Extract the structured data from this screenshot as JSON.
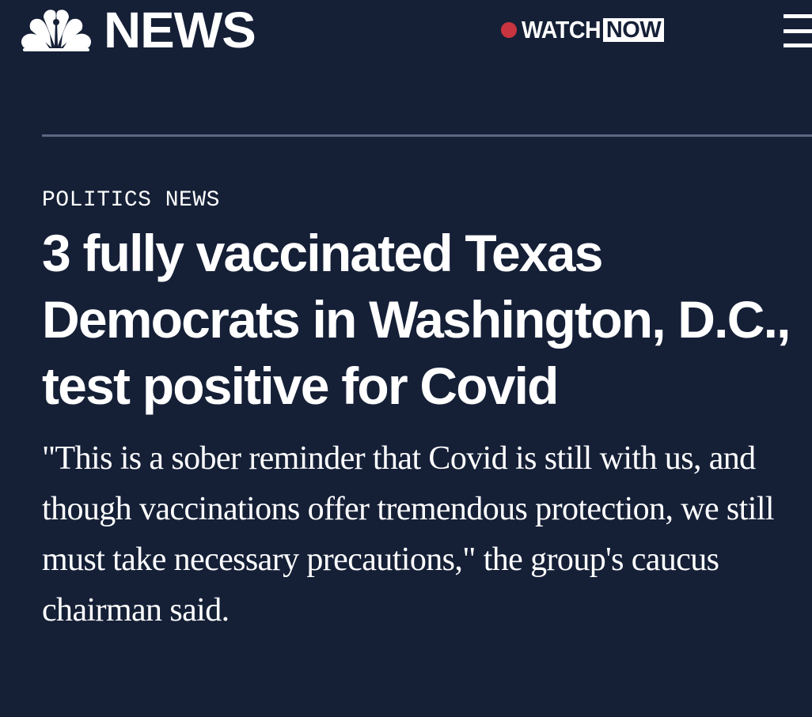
{
  "header": {
    "logo_text": "NEWS",
    "watch_label": "WATCH",
    "now_label": "NOW",
    "icons": {
      "logo": "nbc-peacock-icon",
      "live": "live-dot-icon",
      "menu": "hamburger-menu-icon"
    },
    "colors": {
      "background": "#152037",
      "live_dot": "#c8343f",
      "divider": "#5a6682"
    }
  },
  "article": {
    "section": "POLITICS NEWS",
    "headline": "3 fully vaccinated Texas Democrats in Washington, D.C., test positive for Covid",
    "dek": "\"This is a sober reminder that Covid is still with us, and though vaccinations offer tremendous protection, we still must take necessary precautions,\" the group's caucus chairman said."
  }
}
